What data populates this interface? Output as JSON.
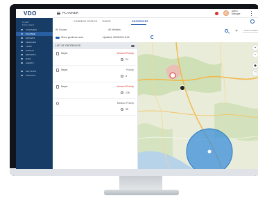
{
  "app": {
    "logo": "VDO",
    "title": "PLANNER",
    "user": {
      "line1": "admin",
      "line2": "Manager"
    }
  },
  "sidebar": {
    "brand": [
      "FLEET",
      "MANAGER"
    ],
    "items": [
      {
        "label": "OVERVIEW",
        "active": false
      },
      {
        "label": "PLANNER",
        "active": true
      },
      {
        "label": "DRIVERS",
        "active": false
      },
      {
        "label": "VEHICLES",
        "active": false
      },
      {
        "label": "TRIPS",
        "active": false
      },
      {
        "label": "EVENTS",
        "active": false
      },
      {
        "label": "REPORTS",
        "active": false
      },
      {
        "label": "DATA",
        "active": false
      },
      {
        "label": "ALERTS",
        "active": false
      },
      {
        "label": "SETTINGS",
        "active": false
      },
      {
        "label": "SUPPORT",
        "active": false
      }
    ]
  },
  "tabs": [
    {
      "label": "CURRENT STATUS",
      "active": false
    },
    {
      "label": "TRACE",
      "active": false
    },
    {
      "label": "GEOFENCES",
      "active": true
    }
  ],
  "filters": {
    "group_label": "All Groups",
    "vehicles_label": "All Vehicles",
    "toggle_label": "Show geofence area",
    "updated_label": "Updated: 06/06/18 18:16",
    "search_placeholder": "Search location"
  },
  "panel": {
    "header": "LIST OF GEOFENCES",
    "rows": [
      {
        "name": "Depot",
        "status": "Inbound Priority",
        "status_type": "inbound",
        "count": "24"
      },
      {
        "name": "Depot",
        "status": "Priority",
        "status_type": "outbound",
        "count": "8"
      },
      {
        "name": "Depot",
        "status": "Inbound Priority",
        "status_type": "inbound",
        "count": "126"
      },
      {
        "name": "",
        "status": "Medium Priority",
        "status_type": "outbound",
        "count": "38"
      }
    ]
  },
  "map": {
    "colors": {
      "land": "#e9ecd9",
      "forest": "#c9dbb0",
      "road": "#f2b84b",
      "water": "#b6d3ea",
      "geofence": "#3a8fd9",
      "urban": "#f0b7b7"
    }
  }
}
